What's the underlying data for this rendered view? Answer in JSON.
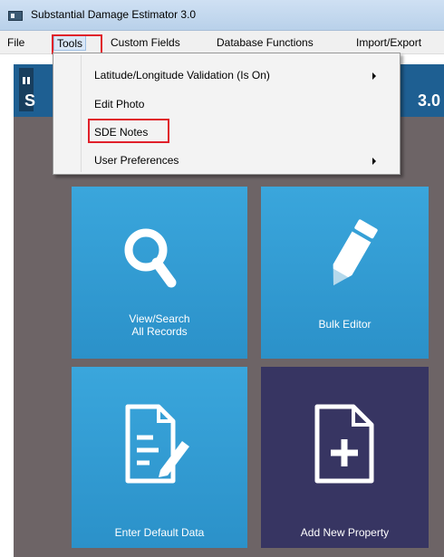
{
  "window": {
    "title": "Substantial Damage Estimator 3.0"
  },
  "menubar": {
    "items": [
      "File",
      "Tools",
      "Custom Fields",
      "Database Functions",
      "Import/Export"
    ]
  },
  "banner": {
    "letter": "S",
    "version": "3.0"
  },
  "tools_menu": {
    "items": [
      {
        "label": "Latitude/Longitude Validation (Is On)",
        "submenu": true
      },
      {
        "label": "Edit Photo",
        "submenu": false
      },
      {
        "label": "SDE Notes",
        "submenu": false
      },
      {
        "label": "User Preferences",
        "submenu": true
      }
    ]
  },
  "tiles": {
    "view_search": {
      "line1": "View/Search",
      "line2": "All Records",
      "icon": "search-icon"
    },
    "bulk_editor": {
      "label": "Bulk Editor",
      "icon": "pencil-icon"
    },
    "default_data": {
      "label": "Enter Default Data",
      "icon": "document-edit-icon"
    },
    "add_property": {
      "label": "Add New Property",
      "icon": "file-plus-icon"
    }
  },
  "colors": {
    "tile_blue": "#2f9ad1",
    "tile_dark": "#373562",
    "banner": "#1e5f92",
    "highlight": "#e0202a"
  }
}
